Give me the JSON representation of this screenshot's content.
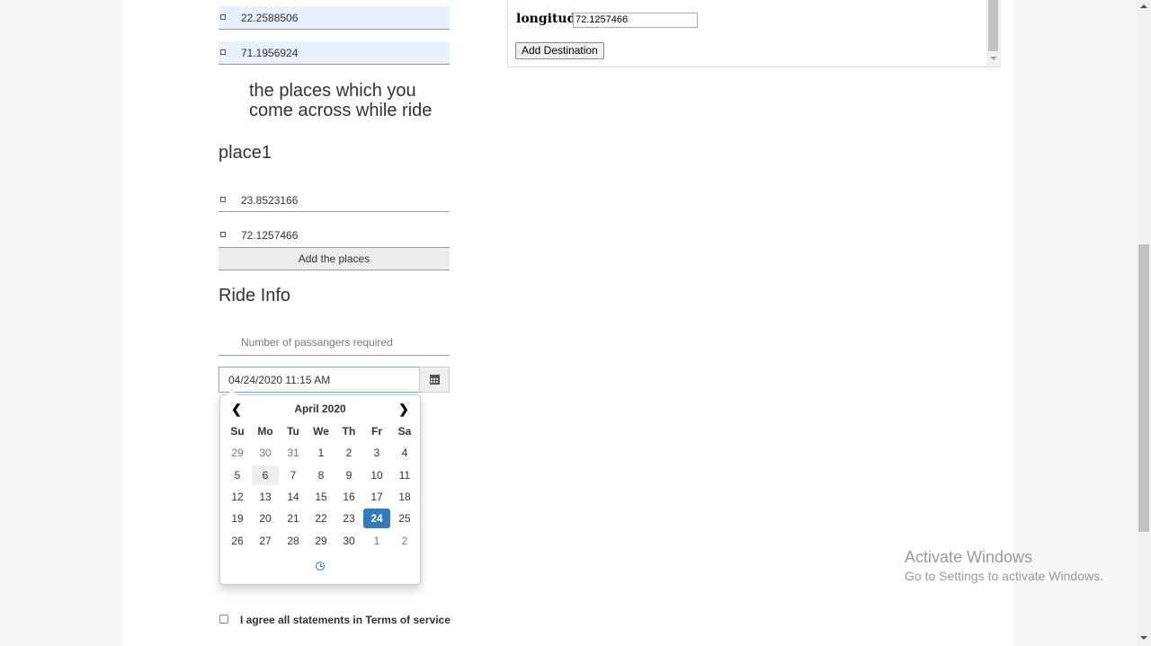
{
  "places": {
    "start_lat": "22.2588506",
    "start_lng": "71.1956924",
    "section_title": "the places which you come across while ride",
    "place_heading": "place1",
    "place_lat": "23.8523166",
    "place_lng": "72.1257466",
    "add_button": "Add the places"
  },
  "ride": {
    "heading": "Ride Info",
    "passengers_placeholder": "Number of passangers required",
    "datetime_value": "04/24/2020 11:15 AM"
  },
  "datepicker": {
    "title": "April 2020",
    "prev_icon": "chevron-left-icon",
    "next_icon": "chevron-right-icon",
    "weekdays": [
      "Su",
      "Mo",
      "Tu",
      "We",
      "Th",
      "Fr",
      "Sa"
    ],
    "weeks": [
      [
        {
          "d": "29",
          "m": true
        },
        {
          "d": "30",
          "m": true
        },
        {
          "d": "31",
          "m": true
        },
        {
          "d": "1"
        },
        {
          "d": "2"
        },
        {
          "d": "3"
        },
        {
          "d": "4"
        }
      ],
      [
        {
          "d": "5"
        },
        {
          "d": "6",
          "today": true
        },
        {
          "d": "7"
        },
        {
          "d": "8"
        },
        {
          "d": "9"
        },
        {
          "d": "10"
        },
        {
          "d": "11"
        }
      ],
      [
        {
          "d": "12"
        },
        {
          "d": "13"
        },
        {
          "d": "14"
        },
        {
          "d": "15"
        },
        {
          "d": "16"
        },
        {
          "d": "17"
        },
        {
          "d": "18"
        }
      ],
      [
        {
          "d": "19"
        },
        {
          "d": "20"
        },
        {
          "d": "21"
        },
        {
          "d": "22"
        },
        {
          "d": "23"
        },
        {
          "d": "24",
          "active": true
        },
        {
          "d": "25"
        }
      ],
      [
        {
          "d": "26"
        },
        {
          "d": "27"
        },
        {
          "d": "28"
        },
        {
          "d": "29"
        },
        {
          "d": "30"
        },
        {
          "d": "1",
          "m": true
        },
        {
          "d": "2",
          "m": true
        }
      ]
    ],
    "selected_color": "#337ab7",
    "time_toggle_icon": "clock-icon"
  },
  "terms": {
    "label": "I agree all statements in Terms of service"
  },
  "destination": {
    "longitude_label": "longitude",
    "longitude_value": "72.1257466",
    "add_button": "Add Destination"
  },
  "watermark": {
    "line1": "Activate Windows",
    "line2": "Go to Settings to activate Windows."
  }
}
